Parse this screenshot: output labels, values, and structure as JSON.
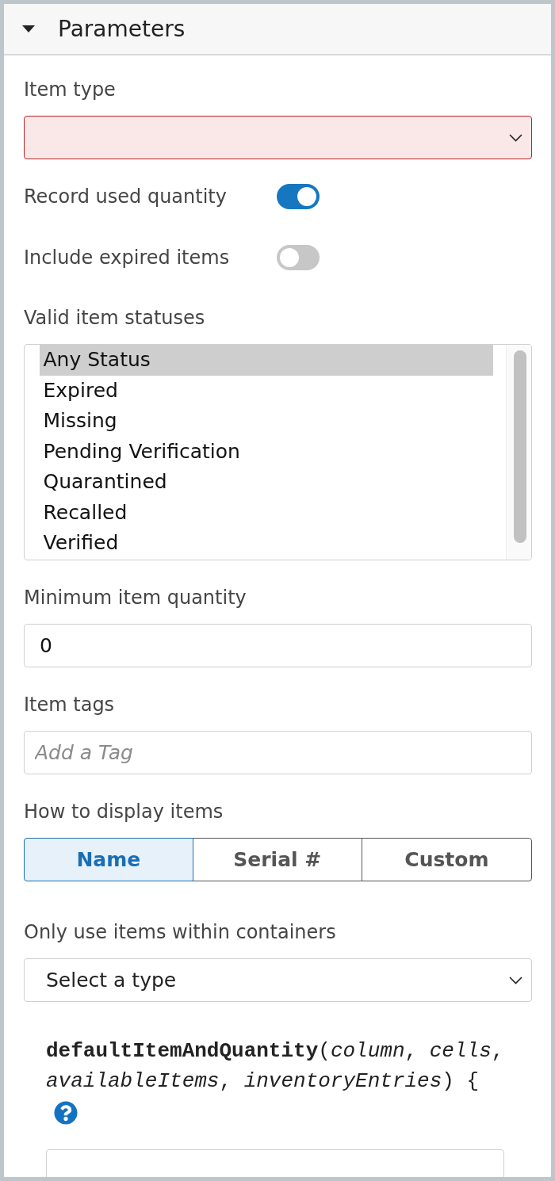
{
  "panel": {
    "title": "Parameters",
    "expanded": true
  },
  "fields": [
    {
      "kind": "select",
      "label": "Item type",
      "invalid": true
    },
    {
      "kind": "toggle",
      "label": "Record used quantity",
      "on": true
    },
    {
      "kind": "toggle",
      "label": "Include expired items",
      "on": false
    },
    {
      "kind": "listbox",
      "label": "Valid item statuses",
      "options": [
        {
          "label": "Any Status",
          "selected": true
        },
        {
          "label": "Expired",
          "selected": false
        },
        {
          "label": "Missing",
          "selected": false
        },
        {
          "label": "Pending Verification",
          "selected": false
        },
        {
          "label": "Quarantined",
          "selected": false
        },
        {
          "label": "Recalled",
          "selected": false
        },
        {
          "label": "Verified",
          "selected": false
        }
      ]
    },
    {
      "kind": "input",
      "label": "Minimum item quantity",
      "value": "0"
    },
    {
      "kind": "input",
      "label": "Item tags",
      "placeholder": "Add a Tag"
    },
    {
      "kind": "segmented",
      "label": "How to display items",
      "options": [
        {
          "label": "Name",
          "selected": true
        },
        {
          "label": "Serial #",
          "selected": false
        },
        {
          "label": "Custom",
          "selected": false
        }
      ]
    },
    {
      "kind": "select",
      "label": "Only use items within containers",
      "value": "Select a type",
      "invalid": false
    }
  ],
  "code": {
    "signature": "**defaultItemAndQuantity**(*column*, *cells*, *availableItems*, *inventoryEntries*) {"
  }
}
